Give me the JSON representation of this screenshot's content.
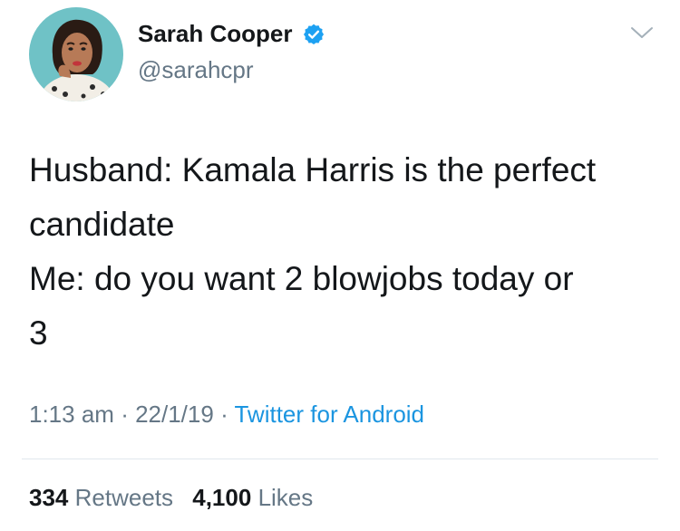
{
  "author": {
    "name": "Sarah Cooper",
    "handle": "@sarahcpr",
    "verified": true
  },
  "tweet": {
    "lines": [
      "Husband: Kamala Harris is the perfect",
      "candidate",
      "Me: do you want 2 blowjobs today or",
      "3"
    ]
  },
  "meta": {
    "time": "1:13 am",
    "date": "22/1/19",
    "source": "Twitter for Android"
  },
  "stats": {
    "retweets_count": "334",
    "retweets_label": "Retweets",
    "likes_count": "4,100",
    "likes_label": "Likes"
  },
  "colors": {
    "link": "#1b95e0",
    "muted": "#657786",
    "text": "#14171a",
    "verified_badge": "#1da1f2"
  },
  "icons": {
    "verified": "verified-badge-icon",
    "menu": "chevron-down-icon"
  }
}
